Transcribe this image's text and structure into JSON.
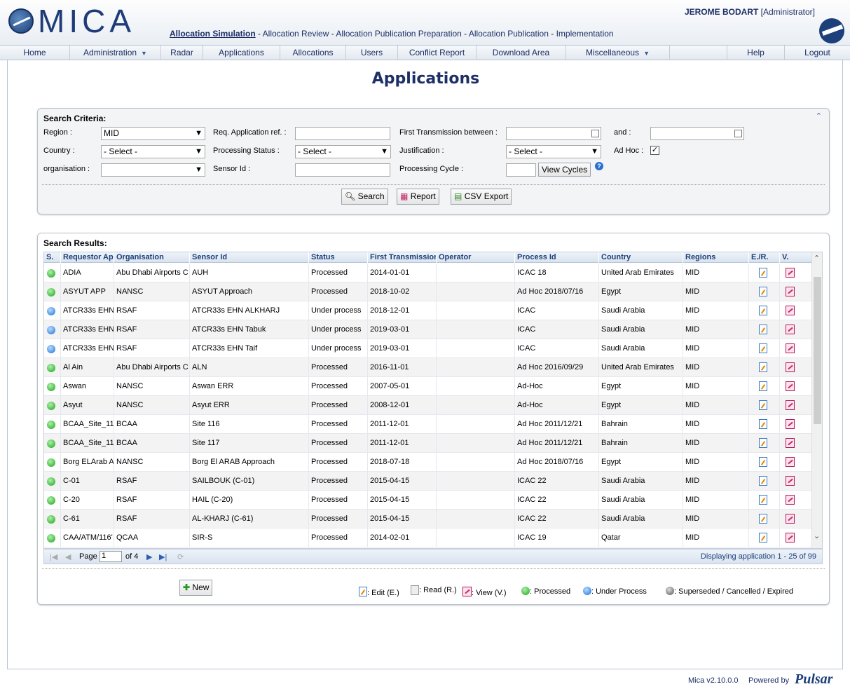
{
  "header": {
    "logo_text": "MICA",
    "steps": [
      "Allocation Simulation",
      " - Allocation Review - Allocation Publication Preparation - Allocation Publication - Implementation"
    ],
    "user_name": "JEROME BODART",
    "user_role": "[Administrator]"
  },
  "nav": {
    "items": [
      "Home",
      "Administration",
      "Radar",
      "Applications",
      "Allocations",
      "Users",
      "Conflict Report",
      "Download Area",
      "Miscellaneous",
      "",
      "Help",
      "Logout"
    ]
  },
  "page_title": "Applications",
  "search": {
    "title": "Search Criteria:",
    "region_label": "Region :",
    "region_value": "MID",
    "req_ref_label": "Req. Application ref. :",
    "first_tx_label": "First Transmission between :",
    "and_label": "and :",
    "country_label": "Country :",
    "country_value": "- Select -",
    "proc_status_label": "Processing Status :",
    "proc_status_value": "- Select -",
    "justification_label": "Justification :",
    "justification_value": "- Select -",
    "adhoc_label": "Ad Hoc :",
    "adhoc_checked": "✓",
    "organisation_label": "organisation :",
    "organisation_value": "",
    "sensor_label": "Sensor Id :",
    "cycle_label": "Processing Cycle :",
    "view_cycles": "View Cycles",
    "search_btn": "Search",
    "report_btn": "Report",
    "csv_btn": "CSV Export"
  },
  "results": {
    "title": "Search Results:",
    "columns": [
      "S.",
      "Requestor Ap",
      "Organisation",
      "Sensor Id",
      "Status",
      "First Transmission",
      "Operator",
      "Process Id",
      "Country",
      "Regions",
      "E./R.",
      "V."
    ],
    "rows": [
      {
        "s": "green",
        "req": "ADIA",
        "org": "Abu Dhabi Airports C",
        "sensor": "AUH",
        "status": "Processed",
        "first": "2014-01-01",
        "op": "",
        "proc": "ICAC 18",
        "country": "United Arab Emirates",
        "region": "MID"
      },
      {
        "s": "green",
        "req": "ASYUT APP",
        "org": "NANSC",
        "sensor": "ASYUT Approach",
        "status": "Processed",
        "first": "2018-10-02",
        "op": "",
        "proc": "Ad Hoc 2018/07/16",
        "country": "Egypt",
        "region": "MID"
      },
      {
        "s": "blue",
        "req": "ATCR33s EHN",
        "org": "RSAF",
        "sensor": "ATCR33s EHN ALKHARJ",
        "status": "Under process",
        "first": "2018-12-01",
        "op": "",
        "proc": "ICAC",
        "country": "Saudi Arabia",
        "region": "MID"
      },
      {
        "s": "blue",
        "req": "ATCR33s EHN",
        "org": "RSAF",
        "sensor": "ATCR33s EHN Tabuk",
        "status": "Under process",
        "first": "2019-03-01",
        "op": "",
        "proc": "ICAC",
        "country": "Saudi Arabia",
        "region": "MID"
      },
      {
        "s": "blue",
        "req": "ATCR33s EHN",
        "org": "RSAF",
        "sensor": "ATCR33s EHN Taif",
        "status": "Under process",
        "first": "2019-03-01",
        "op": "",
        "proc": "ICAC",
        "country": "Saudi Arabia",
        "region": "MID"
      },
      {
        "s": "green",
        "req": "Al Ain",
        "org": "Abu Dhabi Airports C",
        "sensor": "ALN",
        "status": "Processed",
        "first": "2016-11-01",
        "op": "",
        "proc": "Ad Hoc 2016/09/29",
        "country": "United Arab Emirates",
        "region": "MID"
      },
      {
        "s": "green",
        "req": "Aswan",
        "org": "NANSC",
        "sensor": "Aswan ERR",
        "status": "Processed",
        "first": "2007-05-01",
        "op": "",
        "proc": "Ad-Hoc",
        "country": "Egypt",
        "region": "MID"
      },
      {
        "s": "green",
        "req": "Asyut",
        "org": "NANSC",
        "sensor": "Asyut ERR",
        "status": "Processed",
        "first": "2008-12-01",
        "op": "",
        "proc": "Ad-Hoc",
        "country": "Egypt",
        "region": "MID"
      },
      {
        "s": "green",
        "req": "BCAA_Site_11",
        "org": "BCAA",
        "sensor": "Site 116",
        "status": "Processed",
        "first": "2011-12-01",
        "op": "",
        "proc": "Ad Hoc 2011/12/21",
        "country": "Bahrain",
        "region": "MID"
      },
      {
        "s": "green",
        "req": "BCAA_Site_11",
        "org": "BCAA",
        "sensor": "Site 117",
        "status": "Processed",
        "first": "2011-12-01",
        "op": "",
        "proc": "Ad Hoc 2011/12/21",
        "country": "Bahrain",
        "region": "MID"
      },
      {
        "s": "green",
        "req": "Borg ELArab A",
        "org": "NANSC",
        "sensor": "Borg El ARAB Approach",
        "status": "Processed",
        "first": "2018-07-18",
        "op": "",
        "proc": "Ad Hoc 2018/07/16",
        "country": "Egypt",
        "region": "MID"
      },
      {
        "s": "green",
        "req": "C-01",
        "org": "RSAF",
        "sensor": "SAILBOUK (C-01)",
        "status": "Processed",
        "first": "2015-04-15",
        "op": "",
        "proc": "ICAC 22",
        "country": "Saudi Arabia",
        "region": "MID"
      },
      {
        "s": "green",
        "req": "C-20",
        "org": "RSAF",
        "sensor": "HAIL (C-20)",
        "status": "Processed",
        "first": "2015-04-15",
        "op": "",
        "proc": "ICAC 22",
        "country": "Saudi Arabia",
        "region": "MID"
      },
      {
        "s": "green",
        "req": "C-61",
        "org": "RSAF",
        "sensor": "AL-KHARJ (C-61)",
        "status": "Processed",
        "first": "2015-04-15",
        "op": "",
        "proc": "ICAC 22",
        "country": "Saudi Arabia",
        "region": "MID"
      },
      {
        "s": "green",
        "req": "CAA/ATM/116'",
        "org": "QCAA",
        "sensor": "SIR-S",
        "status": "Processed",
        "first": "2014-02-01",
        "op": "",
        "proc": "ICAC 19",
        "country": "Qatar",
        "region": "MID"
      }
    ]
  },
  "pager": {
    "page_label": "Page",
    "page_value": "1",
    "of_label": "of 4",
    "display": "Displaying application 1 - 25 of 99"
  },
  "legend": {
    "new_btn": "New",
    "edit": ": Edit (E.)",
    "read": ": Read (R.)",
    "view": ": View (V.)",
    "processed": ": Processed",
    "under": ": Under Process",
    "superseded": ": Superseded / Cancelled / Expired"
  },
  "footer": {
    "version": "Mica v2.10.0.0",
    "powered": "Powered by",
    "brand": "Pulsar"
  }
}
